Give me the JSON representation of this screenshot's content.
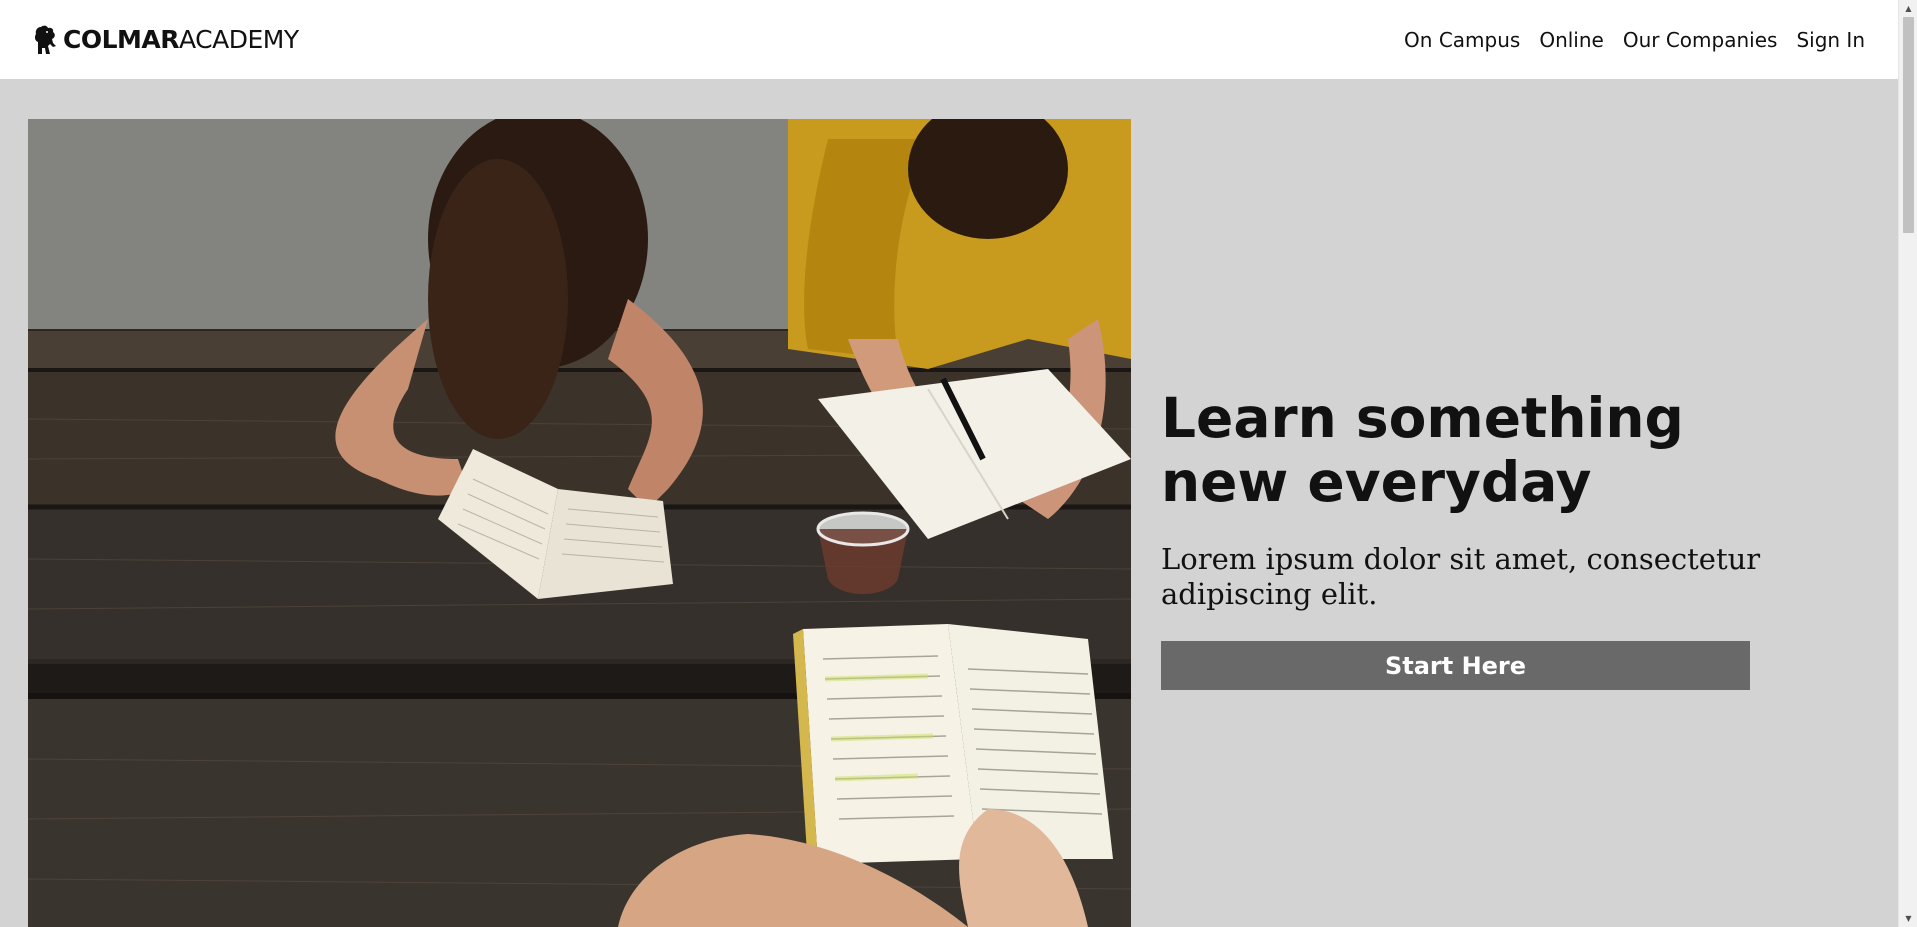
{
  "header": {
    "logo_bold": "COLMAR",
    "logo_light": "ACADEMY",
    "logo_icon": "lion-icon",
    "nav": [
      {
        "label": "On Campus"
      },
      {
        "label": "Online"
      },
      {
        "label": "Our Companies"
      },
      {
        "label": "Sign In"
      }
    ]
  },
  "hero": {
    "image_icon": "students-studying-photo",
    "title": "Learn something new everyday",
    "subtitle": "Lorem ipsum dolor sit amet, consectetur adipiscing elit.",
    "cta_label": "Start Here"
  },
  "colors": {
    "page_background": "#d3d3d3",
    "header_background": "#ffffff",
    "cta_background": "#696969",
    "cta_text": "#ffffff"
  },
  "scrollbar": {
    "up_icon": "chevron-up-icon",
    "down_icon": "chevron-down-icon"
  }
}
